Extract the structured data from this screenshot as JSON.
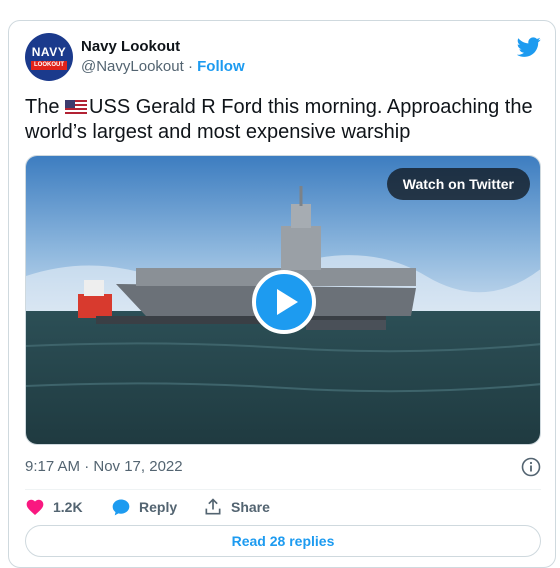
{
  "author": {
    "name": "Navy Lookout",
    "handle": "@NavyLookout",
    "separator": " · ",
    "follow_label": "Follow",
    "avatar_text": "NAVY",
    "avatar_band_text": "LOOKOUT"
  },
  "tweet": {
    "text_prefix": "The ",
    "flag_icon": "us-flag-icon",
    "text_body": "USS Gerald R Ford this morning. Approaching the world’s largest and most expensive warship"
  },
  "media": {
    "watch_label": "Watch on Twitter",
    "play_icon": "play-icon"
  },
  "meta": {
    "timestamp": "9:17 AM · Nov 17, 2022"
  },
  "actions": {
    "like_count": "1.2K",
    "reply_label": "Reply",
    "share_label": "Share"
  },
  "read_replies_label": "Read 28 replies",
  "colors": {
    "accent": "#1d9bf0",
    "like": "#f91880",
    "text": "#0f1419",
    "muted": "#536471"
  }
}
